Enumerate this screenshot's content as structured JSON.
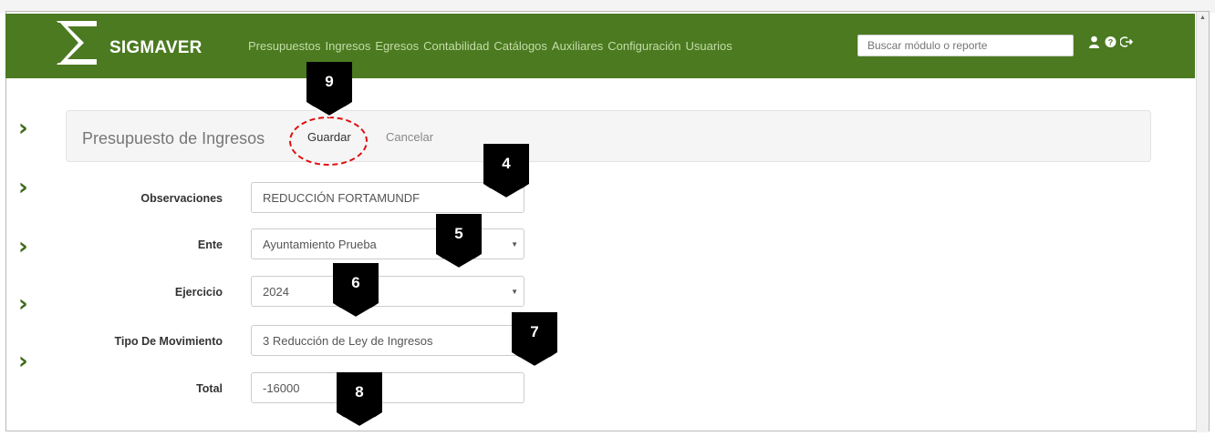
{
  "app": {
    "brand": "SIGMAVER"
  },
  "nav": {
    "menu": [
      "Presupuestos",
      "Ingresos",
      "Egresos",
      "Contabilidad",
      "Catálogos",
      "Auxiliares",
      "Configuración",
      "Usuarios"
    ],
    "search_placeholder": "Buscar módulo o reporte",
    "icons": [
      "user-icon",
      "help-icon",
      "logout-icon"
    ]
  },
  "panel": {
    "title": "Presupuesto de Ingresos",
    "save_label": "Guardar",
    "cancel_label": "Cancelar"
  },
  "form": {
    "observaciones": {
      "label": "Observaciones",
      "value": "REDUCCIÓN FORTAMUNDF"
    },
    "ente": {
      "label": "Ente",
      "value": "Ayuntamiento Prueba"
    },
    "ejercicio": {
      "label": "Ejercicio",
      "value": "2024"
    },
    "tipo_movimiento": {
      "label": "Tipo De Movimiento",
      "value": "3 Reducción de Ley de Ingresos"
    },
    "total": {
      "label": "Total",
      "value": "-16000"
    }
  },
  "markers": {
    "m9": "9",
    "m4": "4",
    "m5": "5",
    "m6": "6",
    "m7": "7",
    "m8": "8"
  },
  "colors": {
    "navbar": "#4b7a20",
    "nav_link": "#c4dca8",
    "chevron": "#3d6b1a",
    "highlight": "#e01010",
    "marker": "#000000"
  }
}
